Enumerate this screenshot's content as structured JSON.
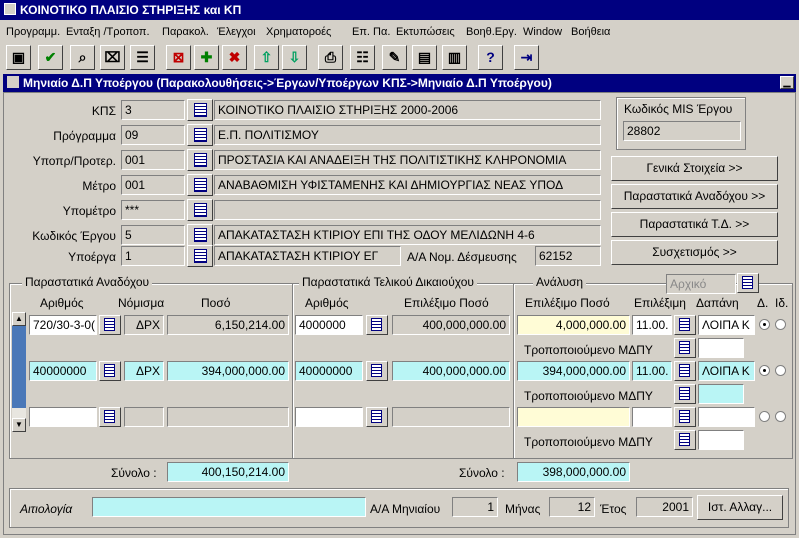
{
  "app": {
    "title": "ΚΟΙΝΟΤΙΚΟ ΠΛΑΙΣΙΟ ΣΤΗΡΙΞΗΣ και ΚΠ"
  },
  "menu": [
    "Προγραμμ.",
    "Ενταξη /Τροποπ.",
    "Παρακολ.",
    "Έλεγχοι",
    "Χρηματοροές",
    "Επ. Πα.",
    "Εκτυπώσεις",
    "Βοηθ.Εργ.",
    "Window",
    "Βοήθεια"
  ],
  "window": {
    "title": "Μηνιαίο Δ.Π Υποέργου (Παρακολουθήσεις->Έργων/Υποέργων ΚΠΣ->Μηνιαίο Δ.Π Υποέργου)"
  },
  "header": {
    "kps": {
      "label": "ΚΠΣ",
      "code": "3",
      "desc": "ΚΟΙΝΟΤΙΚΟ ΠΛΑΙΣΙΟ ΣΤΗΡΙΞΗΣ 2000-2006"
    },
    "programma": {
      "label": "Πρόγραμμα",
      "code": "09",
      "desc": "Ε.Π. ΠΟΛΙΤΙΣΜΟΥ"
    },
    "ypopr": {
      "label": "Υποπρ/Προτερ.",
      "code": "001",
      "desc": "ΠΡΟΣΤΑΣΙΑ ΚΑΙ ΑΝΑΔΕΙΞΗ ΤΗΣ ΠΟΛΙΤΙΣΤΙΚΗΣ ΚΛΗΡΟΝΟΜΙΑ"
    },
    "metro": {
      "label": "Μέτρο",
      "code": "001",
      "desc": "ΑΝΑΒΑΘΜΙΣΗ ΥΦΙΣΤΑΜΕΝΗΣ ΚΑΙ ΔΗΜΙΟΥΡΓΙΑΣ ΝΕΑΣ ΥΠΟΔ"
    },
    "ypometro": {
      "label": "Υπομέτρο",
      "code": "***",
      "desc": ""
    },
    "ergo": {
      "label": "Κωδικός Έργου",
      "code": "5",
      "desc": "ΑΠΑΚΑΤΑΣΤΑΣΗ ΚΤΙΡΙΟΥ ΕΠΙ ΤΗΣ ΟΔΟΥ ΜΕΛΙΔΩΝΗ 4-6"
    },
    "ypoerga": {
      "label": "Υποέργα",
      "code": "1",
      "desc": "ΑΠΑΚΑΤΑΣΤΑΣΗ ΚΤΙΡΙΟΥ ΕΓ",
      "aa_label": "Α/Α Νομ. Δέσμευσης",
      "aa_value": "62152"
    }
  },
  "mis": {
    "label": "Κωδικός MIS Έργου",
    "value": "28802"
  },
  "side_buttons": [
    "Γενικά Στοιχεία >>",
    "Παραστατικά Αναδόχου >>",
    "Παραστατικά Τ.Δ. >>",
    "Συσχετισμός >>"
  ],
  "anadoxos": {
    "title": "Παραστατικά Αναδόχου",
    "col_arithmos": "Αριθμός",
    "col_nomisma": "Νόμισμα",
    "col_poso": "Ποσό",
    "rows": [
      {
        "arithmos": "720/30-3-0(",
        "nomisma": "ΔΡΧ",
        "poso": "6,150,214.00"
      },
      {
        "arithmos": "40000000",
        "nomisma": "ΔΡΧ",
        "poso": "394,000,000.00"
      },
      {
        "arithmos": "",
        "nomisma": "",
        "poso": ""
      }
    ],
    "total_label": "Σύνολο :",
    "total": "400,150,214.00"
  },
  "telikos": {
    "title": "Παραστατικά Τελικού Δικαιούχου",
    "col_arithmos": "Αριθμός",
    "col_poso": "Επιλέξιμο Ποσό",
    "rows": [
      {
        "arithmos": "4000000",
        "poso": "400,000,000.00"
      },
      {
        "arithmos": "40000000",
        "poso": "400,000,000.00"
      },
      {
        "arithmos": "",
        "poso": ""
      }
    ],
    "total_label": "Σύνολο :",
    "total": "398,000,000.00"
  },
  "analysi": {
    "title": "Ανάλυση",
    "filter_placeholder": "Αρχικό",
    "col_poso": "Επιλέξιμο Ποσό",
    "col_epil": "Επιλέξιμη",
    "col_dapani": "Δαπάνη",
    "col_d": "Δ.",
    "col_i": "Ιδ.",
    "mod_label": "Τροποποιούμενο ΜΔΠΥ",
    "rows": [
      {
        "poso": "4,000,000.00",
        "epil": "11.00.",
        "dapani": "ΛΟΙΠΑ Κ"
      },
      {
        "poso": "394,000,000.00",
        "epil": "11.00.",
        "dapani": "ΛΟΙΠΑ Κ"
      },
      {
        "poso": "",
        "epil": "",
        "dapani": ""
      }
    ]
  },
  "footer": {
    "aitiologia_label": "Αιτιολογία",
    "aa_label": "Α/Α Μηνιαίου",
    "aa_value": "1",
    "minas_label": "Μήνας",
    "minas_value": "12",
    "etos_label": "Έτος",
    "etos_value": "2001",
    "history_button": "Ιστ. Αλλαγ..."
  },
  "colors": {
    "title": "#000080",
    "face": "#d4d0c8",
    "cyan_field": "#b9f5f5",
    "yellow_field": "#fffcd6"
  }
}
